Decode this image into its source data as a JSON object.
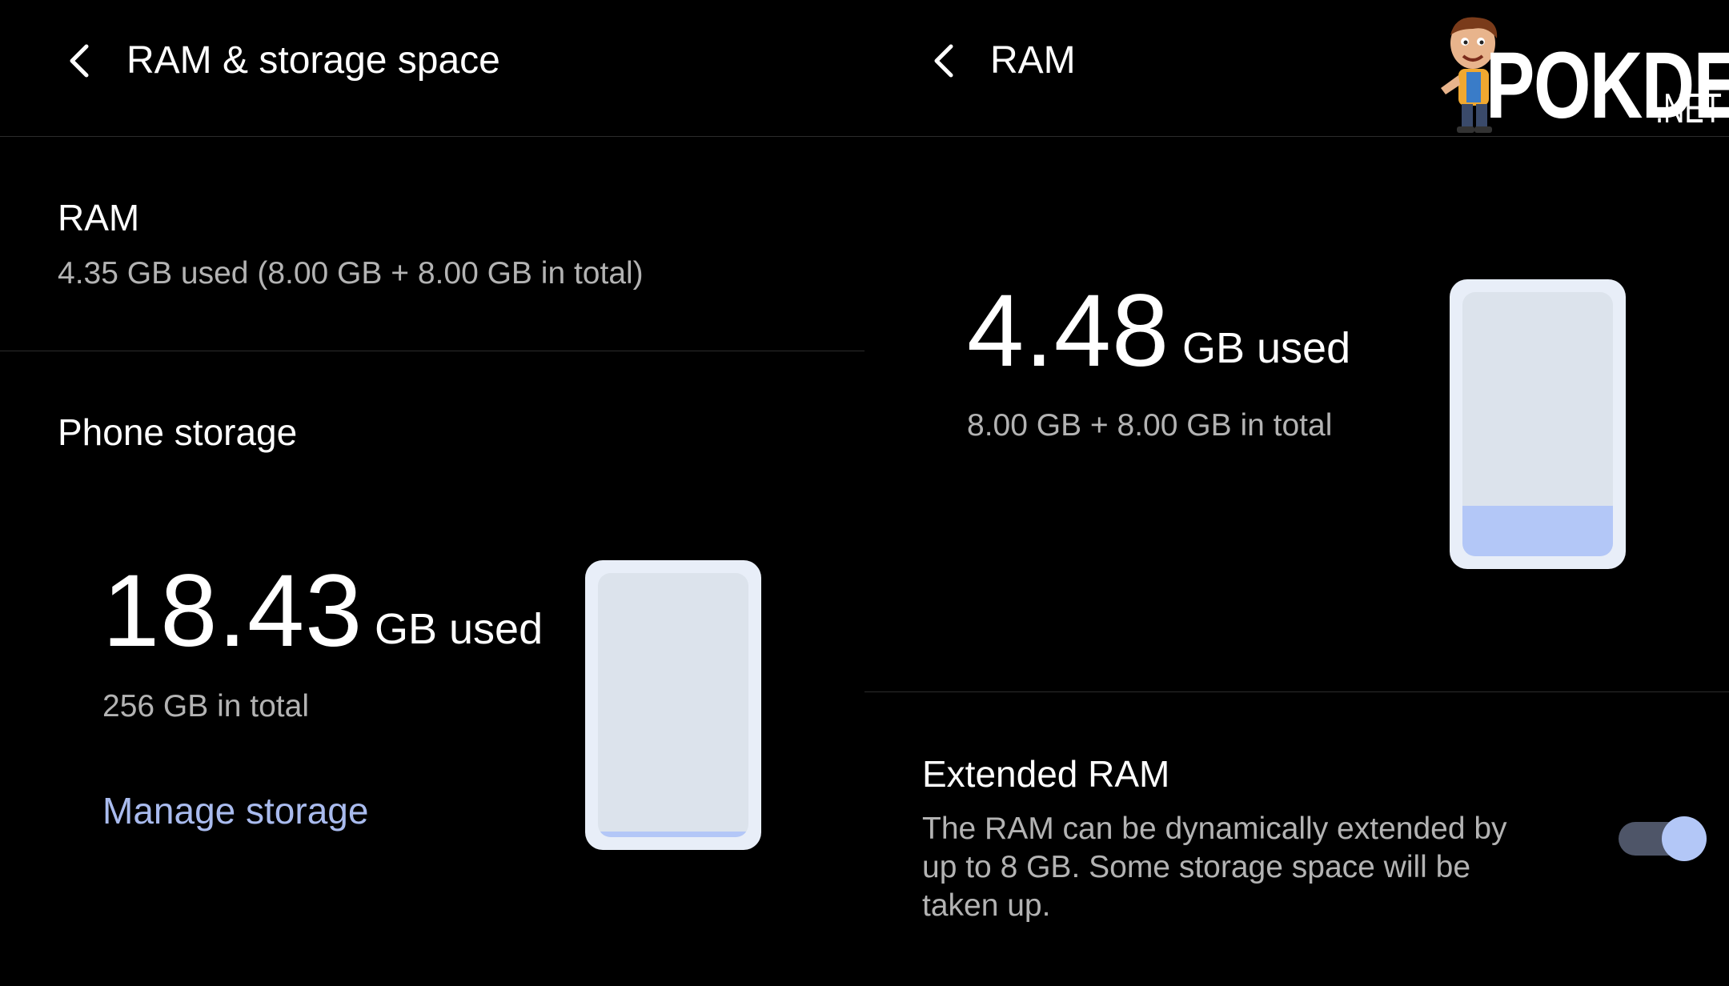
{
  "left": {
    "header": {
      "title": "RAM & storage space"
    },
    "ram": {
      "label": "RAM",
      "summary": "4.35 GB used (8.00 GB + 8.00 GB in total)"
    },
    "storage": {
      "label": "Phone storage",
      "used_value": "18.43",
      "used_unit": "GB used",
      "total": "256 GB in total",
      "manage_link": "Manage storage",
      "fill_fraction": 0.02
    }
  },
  "right": {
    "header": {
      "title": "RAM"
    },
    "ram": {
      "used_value": "4.48",
      "used_unit": "GB used",
      "total": "8.00 GB + 8.00 GB in total",
      "fill_fraction": 0.19
    },
    "extended": {
      "label": "Extended RAM",
      "description": "The RAM can be dynamically extended by up to 8 GB. Some storage space will be taken up.",
      "enabled": true
    }
  },
  "watermark": {
    "brand": "POKDE",
    "suffix": ".NET"
  },
  "colors": {
    "accent": "#b3c7f7",
    "link": "#a9bbee",
    "background": "#000000"
  },
  "icons": {
    "back": "chevron-left-icon",
    "mascot": "mascot-icon"
  }
}
